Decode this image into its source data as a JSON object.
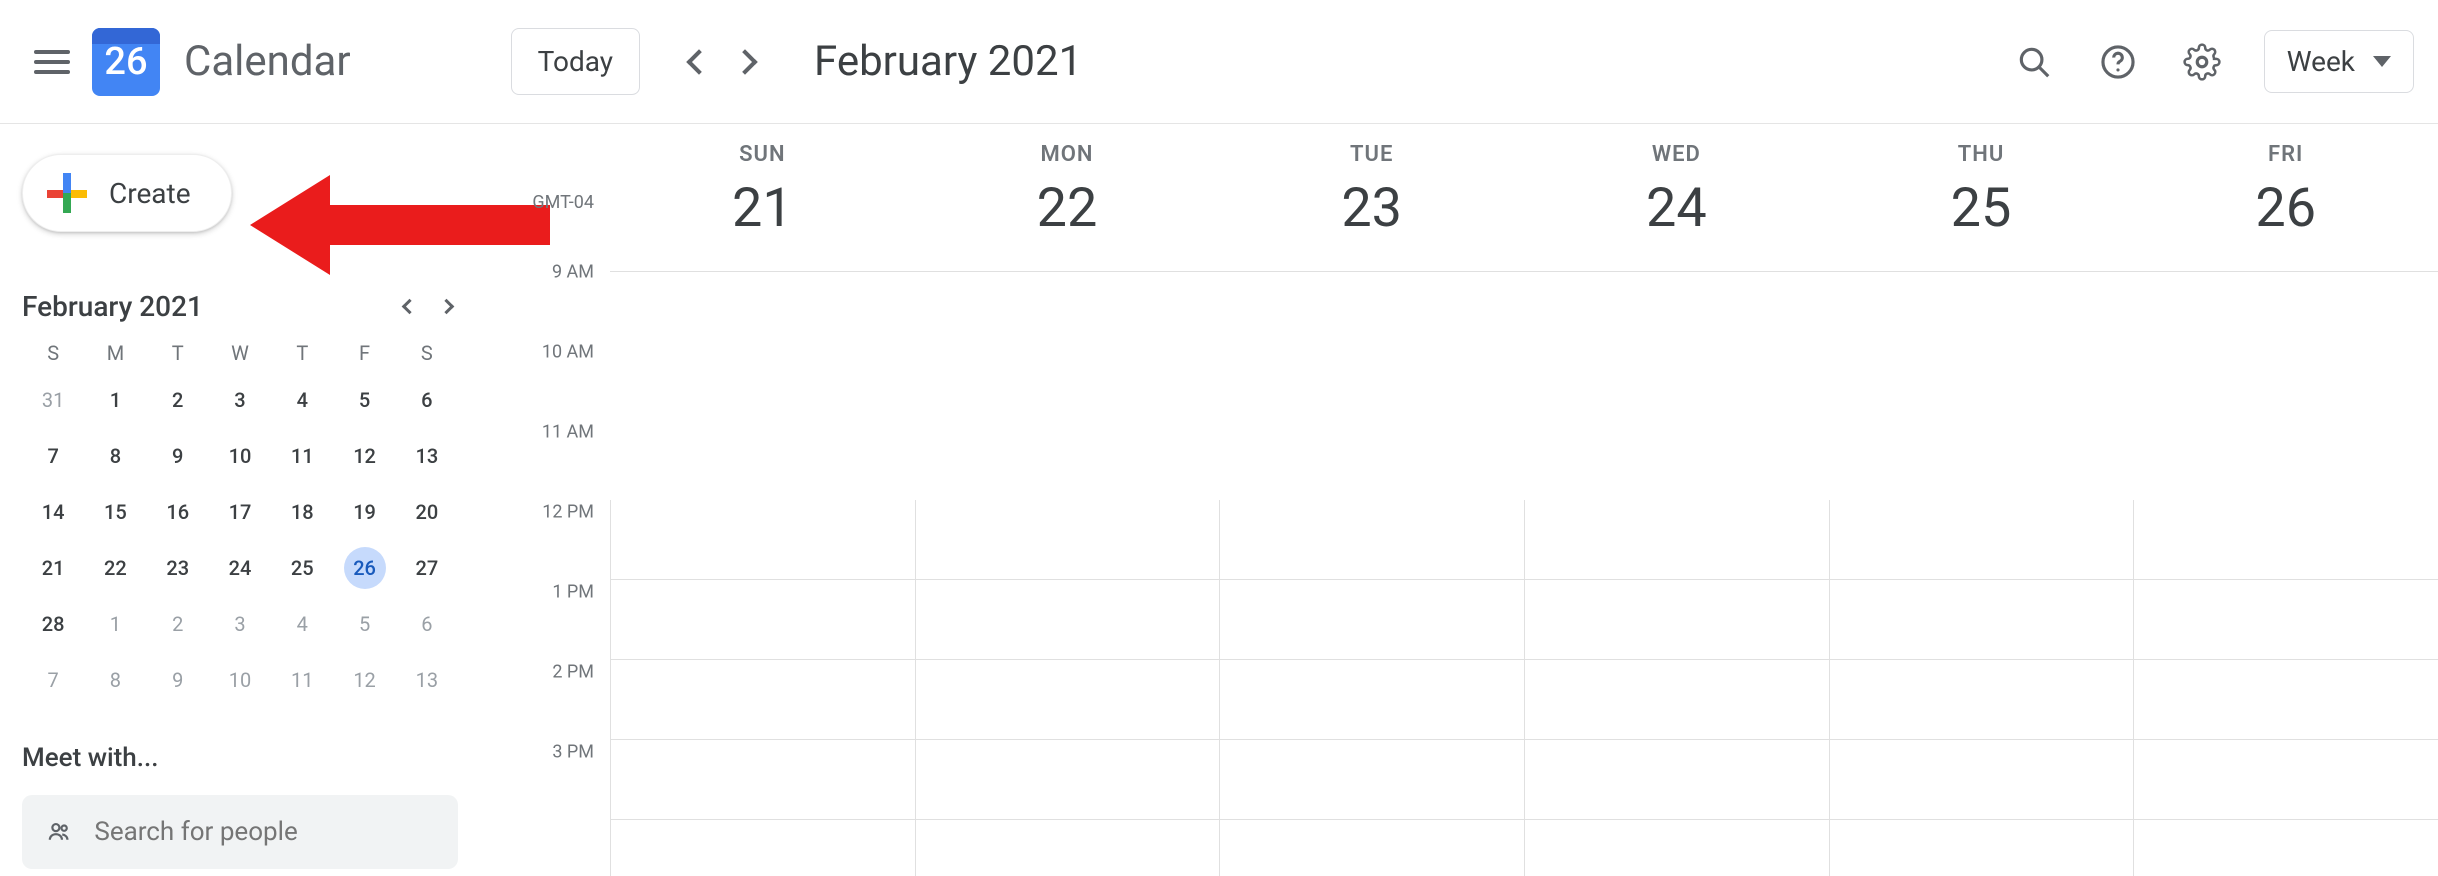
{
  "header": {
    "logo_day": "26",
    "brand": "Calendar",
    "today_label": "Today",
    "period": "February 2021",
    "view_label": "Week"
  },
  "sidebar": {
    "create_label": "Create",
    "mini_month": "February 2021",
    "dow": [
      "S",
      "M",
      "T",
      "W",
      "T",
      "F",
      "S"
    ],
    "weeks": [
      [
        {
          "n": "31",
          "fade": true
        },
        {
          "n": "1"
        },
        {
          "n": "2"
        },
        {
          "n": "3"
        },
        {
          "n": "4"
        },
        {
          "n": "5"
        },
        {
          "n": "6"
        }
      ],
      [
        {
          "n": "7"
        },
        {
          "n": "8"
        },
        {
          "n": "9"
        },
        {
          "n": "10"
        },
        {
          "n": "11"
        },
        {
          "n": "12"
        },
        {
          "n": "13"
        }
      ],
      [
        {
          "n": "14"
        },
        {
          "n": "15"
        },
        {
          "n": "16"
        },
        {
          "n": "17"
        },
        {
          "n": "18"
        },
        {
          "n": "19"
        },
        {
          "n": "20"
        }
      ],
      [
        {
          "n": "21"
        },
        {
          "n": "22"
        },
        {
          "n": "23"
        },
        {
          "n": "24"
        },
        {
          "n": "25"
        },
        {
          "n": "26",
          "today": true
        },
        {
          "n": "27"
        }
      ],
      [
        {
          "n": "28"
        },
        {
          "n": "1",
          "fade": true
        },
        {
          "n": "2",
          "fade": true
        },
        {
          "n": "3",
          "fade": true
        },
        {
          "n": "4",
          "fade": true
        },
        {
          "n": "5",
          "fade": true
        },
        {
          "n": "6",
          "fade": true
        }
      ],
      [
        {
          "n": "7",
          "fade": true
        },
        {
          "n": "8",
          "fade": true
        },
        {
          "n": "9",
          "fade": true
        },
        {
          "n": "10",
          "fade": true
        },
        {
          "n": "11",
          "fade": true
        },
        {
          "n": "12",
          "fade": true
        },
        {
          "n": "13",
          "fade": true
        }
      ]
    ],
    "meet_with": "Meet with...",
    "search_placeholder": "Search for people"
  },
  "timeline": {
    "timezone": "GMT-04",
    "days": [
      {
        "dow": "SUN",
        "num": "21"
      },
      {
        "dow": "MON",
        "num": "22"
      },
      {
        "dow": "TUE",
        "num": "23"
      },
      {
        "dow": "WED",
        "num": "24"
      },
      {
        "dow": "THU",
        "num": "25"
      },
      {
        "dow": "FRI",
        "num": "26"
      }
    ],
    "hours": [
      "9 AM",
      "10 AM",
      "11 AM",
      "12 PM",
      "1 PM",
      "2 PM",
      "3 PM"
    ]
  }
}
